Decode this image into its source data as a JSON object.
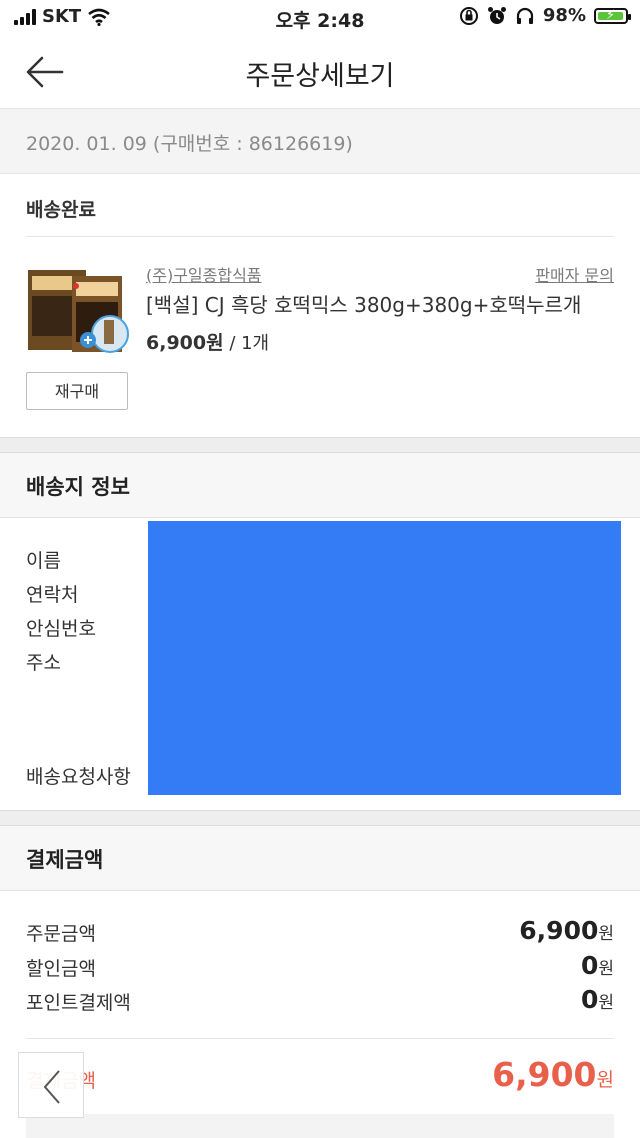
{
  "status_bar": {
    "carrier": "SKT",
    "time": "오후 2:48",
    "battery": "98%"
  },
  "header": {
    "title": "주문상세보기"
  },
  "order": {
    "date_line": "2020. 01. 09 (구매번호 : 86126619)",
    "status": "배송완료"
  },
  "product": {
    "seller": "(주)구일종합식품",
    "seller_inquiry": "판매자 문의",
    "name": "[백설] CJ 흑당 호떡믹스 380g+380g+호떡누르개",
    "price": "6,900원",
    "qty": " / 1개",
    "rebuy_label": "재구매"
  },
  "shipping": {
    "title": "배송지 정보",
    "labels": {
      "name": "이름",
      "phone": "연락처",
      "safe_number": "안심번호",
      "address": "주소",
      "request": "배송요청사항"
    }
  },
  "payment": {
    "title": "결제금액",
    "rows": [
      {
        "label": "주문금액",
        "value": "6,900",
        "unit": "원"
      },
      {
        "label": "할인금액",
        "value": "0",
        "unit": "원"
      },
      {
        "label": "포인트결제액",
        "value": "0",
        "unit": "원"
      }
    ],
    "total_label": "결제금액",
    "total_value": "6,900",
    "total_unit": "원"
  },
  "colors": {
    "accent": "#e8604a",
    "redaction": "#347cf6",
    "battery": "#5cc43a"
  }
}
